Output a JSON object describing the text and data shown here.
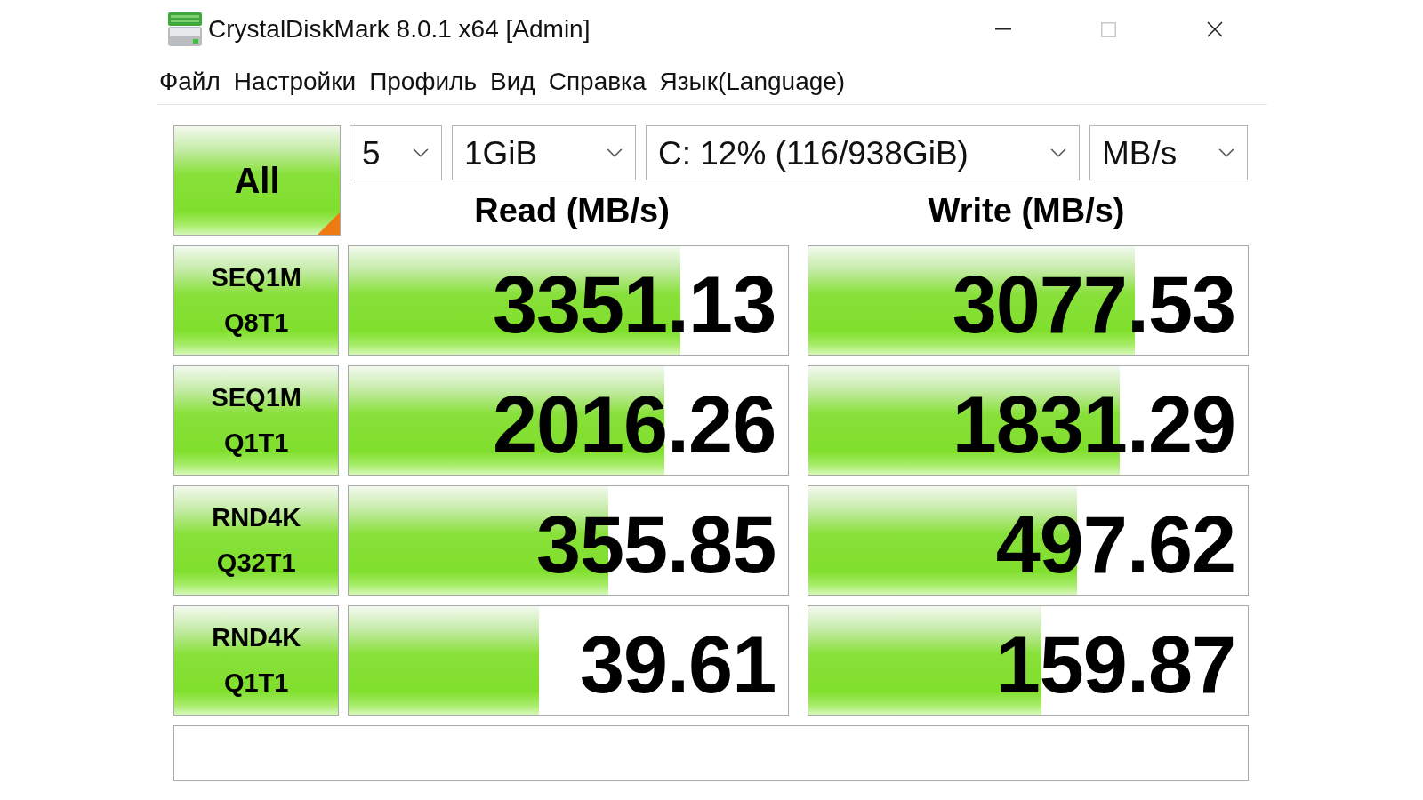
{
  "window": {
    "title": "CrystalDiskMark 8.0.1 x64 [Admin]"
  },
  "menu": [
    "Файл",
    "Настройки",
    "Профиль",
    "Вид",
    "Справка",
    "Язык(Language)"
  ],
  "all_button": {
    "label": "All"
  },
  "settings": {
    "count": "5",
    "size": "1GiB",
    "drive": "C: 12% (116/938GiB)",
    "unit": "MB/s"
  },
  "columns": [
    "Read (MB/s)",
    "Write (MB/s)"
  ],
  "tests": [
    {
      "label": "SEQ1M",
      "sublabel": "Q8T1",
      "read": {
        "value": "3351.13",
        "level": 0.755
      },
      "write": {
        "value": "3077.53",
        "level": 0.743
      }
    },
    {
      "label": "SEQ1M",
      "sublabel": "Q1T1",
      "read": {
        "value": "2016.26",
        "level": 0.718
      },
      "write": {
        "value": "1831.29",
        "level": 0.708
      }
    },
    {
      "label": "RND4K",
      "sublabel": "Q32T1",
      "read": {
        "value": "355.85",
        "level": 0.59
      },
      "write": {
        "value": "497.62",
        "level": 0.612
      }
    },
    {
      "label": "RND4K",
      "sublabel": "Q1T1",
      "read": {
        "value": "39.61",
        "level": 0.433
      },
      "write": {
        "value": "159.87",
        "level": 0.531
      }
    }
  ]
}
